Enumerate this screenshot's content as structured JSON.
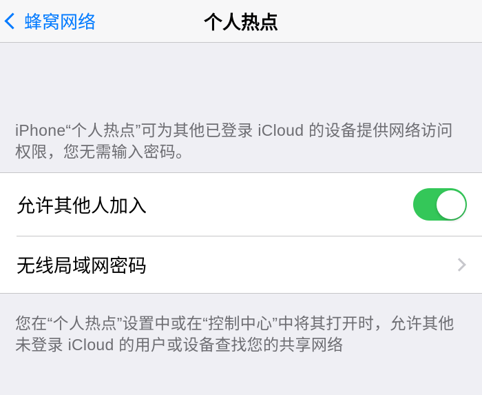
{
  "nav": {
    "back_label": "蜂窝网络",
    "title": "个人热点"
  },
  "header_description": "iPhone“个人热点”可为其他已登录 iCloud 的设备提供网络访问权限，您无需输入密码。",
  "settings": {
    "allow_others": {
      "label": "允许其他人加入",
      "value": true
    },
    "wifi_password": {
      "label": "无线局域网密码"
    }
  },
  "footer_description": "您在“个人热点”设置中或在“控制中心”中将其打开时，允许其他未登录 iCloud 的用户或设备查找您的共享网络",
  "colors": {
    "link": "#007aff",
    "toggle_on": "#34c759",
    "background": "#efeff4",
    "separator": "#c6c6c8",
    "secondary_text": "#6d6d72"
  }
}
